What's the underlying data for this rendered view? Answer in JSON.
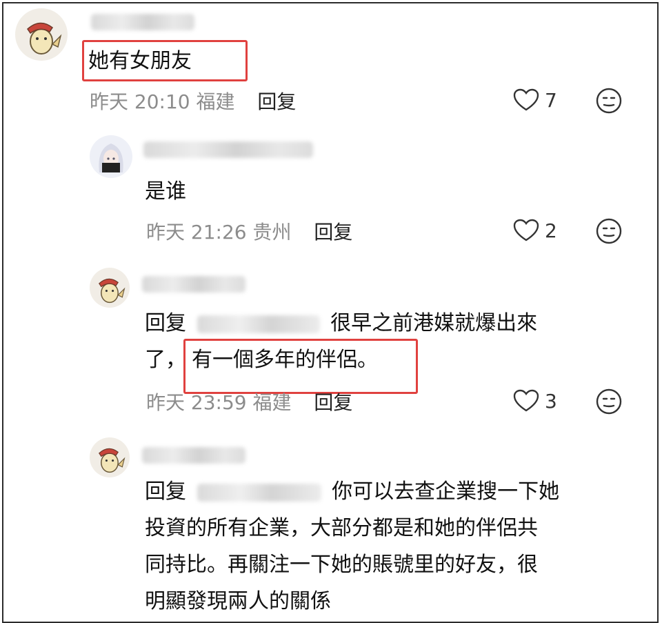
{
  "comments": [
    {
      "text": "她有女朋友",
      "time": "昨天 20:10",
      "location": "福建",
      "reply_label": "回复",
      "likes": "7"
    },
    {
      "text": "是谁",
      "time": "昨天 21:26",
      "location": "贵州",
      "reply_label": "回复",
      "likes": "2"
    },
    {
      "reply_prefix": "回复",
      "text_line1": "很早之前港媒就爆出來",
      "text_line2_a": "了，",
      "text_line2_b": "有一個多年的伴侶。",
      "time": "昨天 23:59",
      "location": "福建",
      "reply_label": "回复",
      "likes": "3"
    },
    {
      "reply_prefix": "回复",
      "text_line1": "你可以去查企業搜一下她",
      "text_line2": "投資的所有企業，大部分都是和她的伴侶共",
      "text_line3": "同持比。再關注一下她的賬號里的好友，很",
      "text_line4": "明顯發現兩人的關係"
    }
  ],
  "colors": {
    "highlight_box": "#e0413f",
    "meta_text": "#8c8c8c"
  },
  "icons": [
    "avatar-pikachu-icon",
    "avatar-anime-girl-icon",
    "heart-outline-icon",
    "emoji-face-icon"
  ]
}
